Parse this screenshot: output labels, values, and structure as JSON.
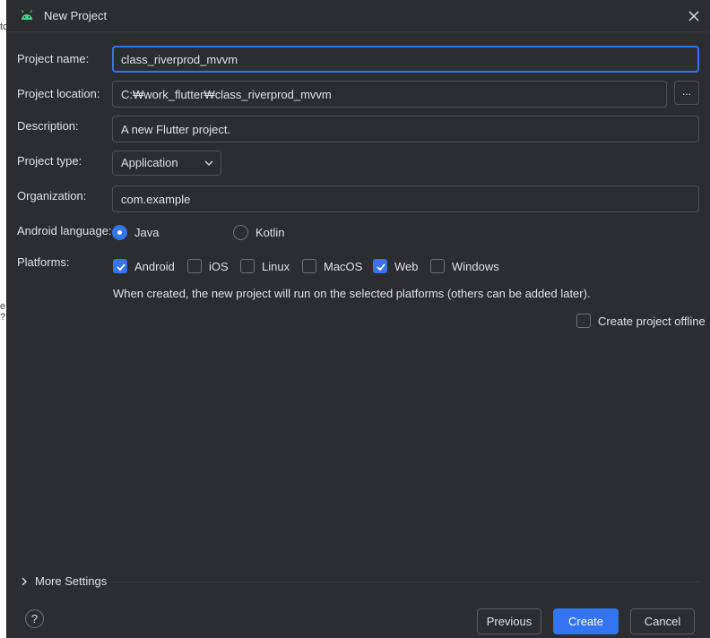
{
  "background": {
    "fragments": [
      "to",
      "e ?"
    ]
  },
  "dialog": {
    "title": "New Project",
    "close_icon": "close-icon",
    "app_icon": "android-icon"
  },
  "form": {
    "project_name": {
      "label": "Project name:",
      "value": "class_riverprod_mvvm"
    },
    "project_location": {
      "label": "Project location:",
      "value": "C:₩work_flutter₩class_riverprod_mvvm",
      "browse_label": "..."
    },
    "description": {
      "label": "Description:",
      "value": "A new Flutter project."
    },
    "project_type": {
      "label": "Project type:",
      "selected": "Application"
    },
    "organization": {
      "label": "Organization:",
      "value": "com.example"
    },
    "android_language": {
      "label": "Android language:",
      "options": [
        {
          "label": "Java",
          "selected": true
        },
        {
          "label": "Kotlin",
          "selected": false
        }
      ]
    },
    "platforms": {
      "label": "Platforms:",
      "options": [
        {
          "label": "Android",
          "checked": true
        },
        {
          "label": "iOS",
          "checked": false
        },
        {
          "label": "Linux",
          "checked": false
        },
        {
          "label": "MacOS",
          "checked": false
        },
        {
          "label": "Web",
          "checked": true
        },
        {
          "label": "Windows",
          "checked": false
        }
      ],
      "hint": "When created, the new project will run on the selected platforms (others can be added later)."
    },
    "offline": {
      "label": "Create project offline",
      "checked": false
    }
  },
  "footer": {
    "more_settings": "More Settings",
    "help": "?",
    "previous": "Previous",
    "create": "Create",
    "cancel": "Cancel"
  },
  "colors": {
    "dialog_bg": "#2b2d30",
    "accent": "#3574f0",
    "border": "#4e5157",
    "text": "#dfe1e5"
  }
}
